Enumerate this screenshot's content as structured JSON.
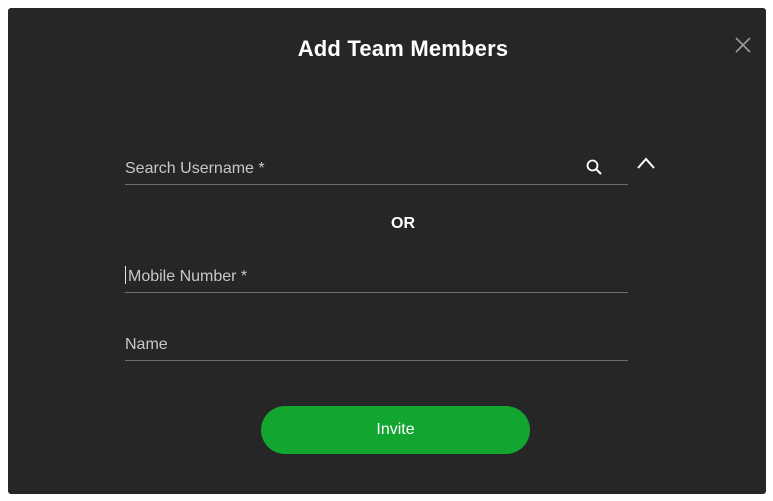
{
  "dialog": {
    "title": "Add Team Members",
    "close_icon": "close-icon"
  },
  "search": {
    "placeholder": "Search Username *",
    "value": "",
    "icon": "search-icon",
    "toggle_icon": "chevron-up-icon"
  },
  "separator": {
    "label": "OR"
  },
  "mobile": {
    "placeholder": "Mobile Number *",
    "value": ""
  },
  "name": {
    "placeholder": "Name",
    "value": ""
  },
  "invite": {
    "label": "Invite"
  },
  "colors": {
    "dialog_background": "#262626",
    "accent_green": "#12a630",
    "underline": "#6e6e6e"
  }
}
